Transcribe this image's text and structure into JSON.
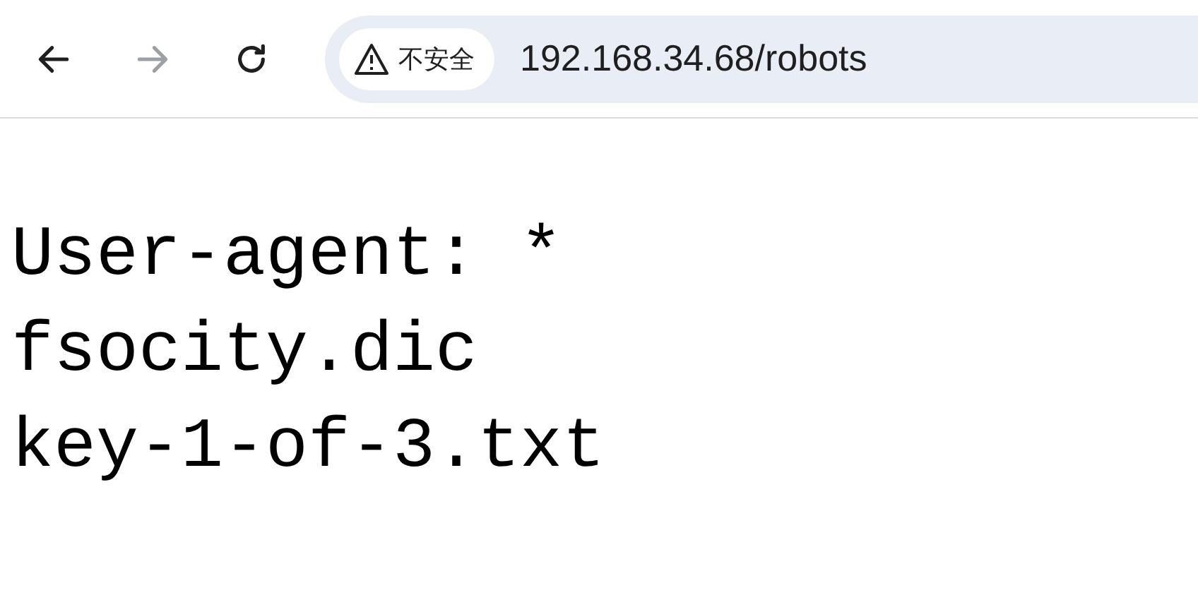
{
  "toolbar": {
    "nav_buttons": [
      {
        "kind": "back",
        "disabled": false
      },
      {
        "kind": "forward",
        "disabled": true
      },
      {
        "kind": "reload",
        "disabled": false
      }
    ],
    "address_bar": {
      "security_label": "不安全",
      "url": "192.168.34.68/robots"
    }
  },
  "content": {
    "lines": [
      "User-agent: *",
      "fsocity.dic",
      "key-1-of-3.txt"
    ]
  }
}
